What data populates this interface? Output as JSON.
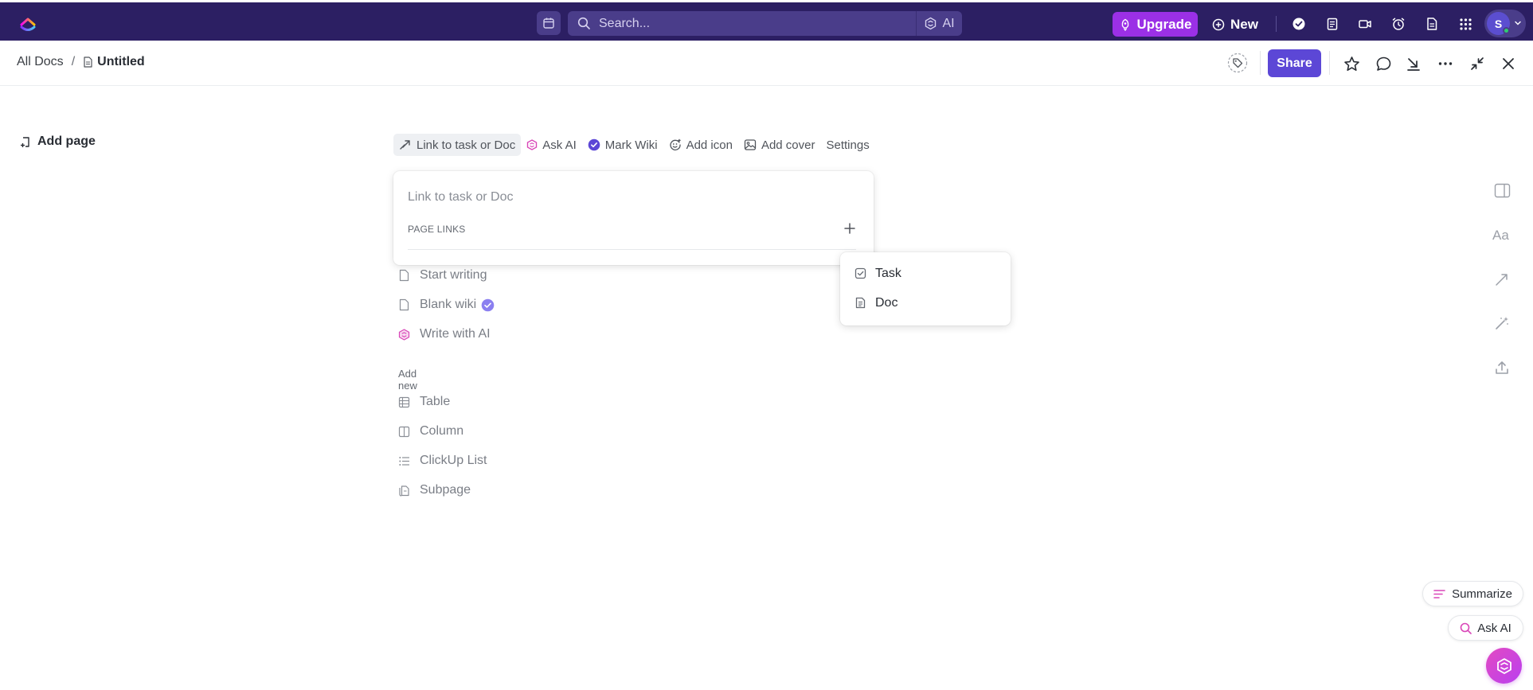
{
  "topbar": {
    "search_placeholder": "Search...",
    "ai_label": "AI",
    "upgrade_label": "Upgrade",
    "new_label": "New",
    "avatar_initial": "S"
  },
  "header": {
    "breadcrumb_root": "All Docs",
    "breadcrumb_separator": "/",
    "doc_title": "Untitled",
    "share_label": "Share"
  },
  "sidebar": {
    "add_page_label": "Add page"
  },
  "doc_toolbar": {
    "items": [
      {
        "label": "Link to task or Doc",
        "icon": "link-icon"
      },
      {
        "label": "Ask AI",
        "icon": "ai-icon"
      },
      {
        "label": "Mark Wiki",
        "icon": "wiki-check-icon"
      },
      {
        "label": "Add icon",
        "icon": "smile-icon"
      },
      {
        "label": "Add cover",
        "icon": "image-icon"
      },
      {
        "label": "Settings",
        "icon": ""
      }
    ]
  },
  "link_popup": {
    "title": "Link to task or Doc",
    "section_label": "PAGE LINKS"
  },
  "type_menu": {
    "items": [
      {
        "label": "Task",
        "icon": "task-checkbox-icon"
      },
      {
        "label": "Doc",
        "icon": "doc-icon"
      }
    ]
  },
  "doc_body": {
    "start_items": [
      {
        "label": "Start writing",
        "icon": "page-icon"
      },
      {
        "label": "Blank wiki",
        "icon": "page-icon"
      },
      {
        "label": "Write with AI",
        "icon": "ai-icon"
      }
    ],
    "add_new_label": "Add new",
    "add_new_items": [
      {
        "label": "Table",
        "icon": "table-icon"
      },
      {
        "label": "Column",
        "icon": "column-icon"
      },
      {
        "label": "ClickUp List",
        "icon": "list-icon"
      },
      {
        "label": "Subpage",
        "icon": "subpage-icon"
      }
    ]
  },
  "assist": {
    "summarize_label": "Summarize",
    "ask_ai_label": "Ask AI"
  },
  "colors": {
    "topbar_bg": "#2c1f63",
    "upgrade_bg": "#9b30e6",
    "share_bg": "#5c47d6",
    "wiki_badge": "#7b68ee",
    "ai_accent": "#d946b8"
  }
}
